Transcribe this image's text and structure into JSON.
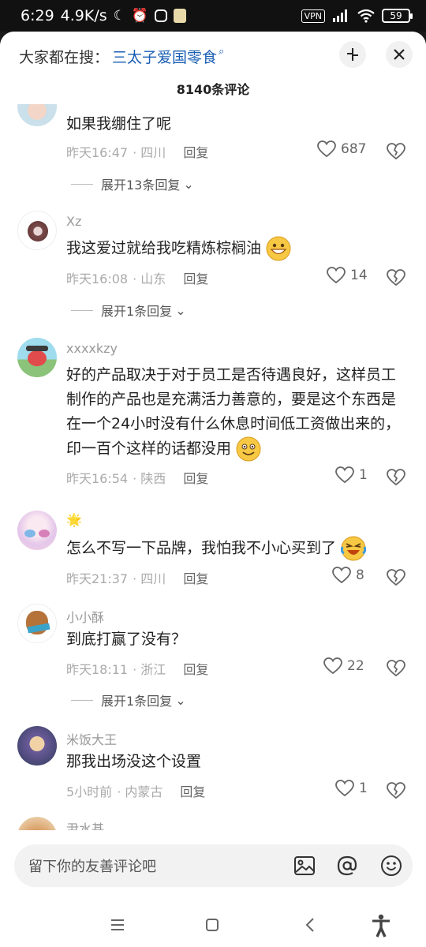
{
  "status": {
    "time": "6:29",
    "speed": "4.9K/s",
    "vpn": "VPN",
    "battery": "59"
  },
  "header": {
    "search_prefix": "大家都在搜：",
    "search_term": "三太子爱国零食",
    "comment_count": "8140条评论"
  },
  "comments": [
    {
      "username": "",
      "text": "如果我绷住了呢",
      "time": "昨天16:47",
      "location": "四川",
      "reply_label": "回复",
      "likes": "687",
      "expand": "展开13条回复"
    },
    {
      "username": "Xz",
      "text": "我这爱过就给我吃精炼棕榈油",
      "time": "昨天16:08",
      "location": "山东",
      "reply_label": "回复",
      "likes": "14",
      "expand": "展开1条回复"
    },
    {
      "username": "xxxxkzy",
      "text": "好的产品取决于对于员工是否待遇良好，这样员工制作的产品也是充满活力善意的，要是这个东西是在一个24小时没有什么休息时间低工资做出来的，印一百个这样的话都没用",
      "time": "昨天16:54",
      "location": "陕西",
      "reply_label": "回复",
      "likes": "1"
    },
    {
      "username": "🌟",
      "text": "怎么不写一下品牌，我怕我不小心买到了",
      "time": "昨天21:37",
      "location": "四川",
      "reply_label": "回复",
      "likes": "8"
    },
    {
      "username": "小小酥",
      "text": "到底打赢了没有？",
      "time": "昨天18:11",
      "location": "浙江",
      "reply_label": "回复",
      "likes": "22",
      "expand": "展开1条回复"
    },
    {
      "username": "米饭大王",
      "text": "那我出场没这个设置",
      "time": "5小时前",
      "location": "内蒙古",
      "reply_label": "回复",
      "likes": "1"
    },
    {
      "username": "尹水基"
    }
  ],
  "input": {
    "placeholder": "留下你的友善评论吧"
  }
}
